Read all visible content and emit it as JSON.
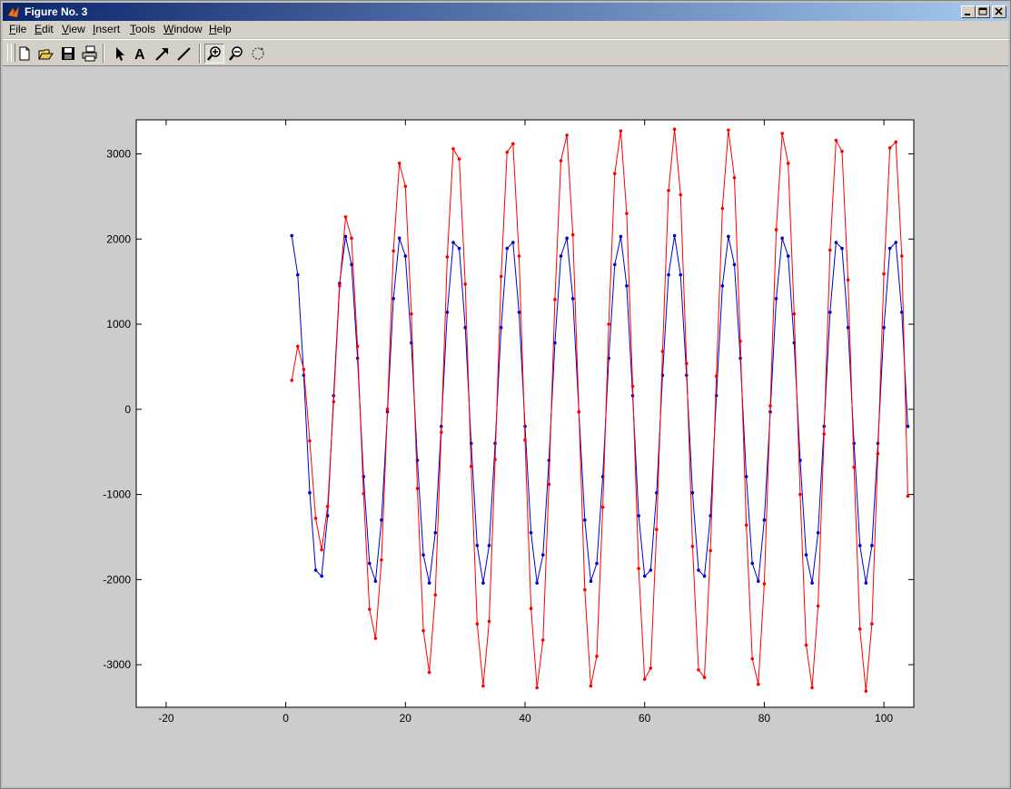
{
  "window": {
    "title": "Figure No. 3",
    "icon": "matlab-logo-icon"
  },
  "menu": [
    {
      "label": "File",
      "key": "F",
      "rest": "ile"
    },
    {
      "label": "Edit",
      "key": "E",
      "rest": "dit"
    },
    {
      "label": "View",
      "key": "V",
      "rest": "iew"
    },
    {
      "label": "Insert",
      "key": "I",
      "rest": "nsert"
    },
    {
      "label": "Tools",
      "key": "T",
      "rest": "ools"
    },
    {
      "label": "Window",
      "key": "W",
      "rest": "indow"
    },
    {
      "label": "Help",
      "key": "H",
      "rest": "elp"
    }
  ],
  "toolbar": [
    "new-file-icon",
    "open-file-icon",
    "save-icon",
    "print-icon",
    "arrow-select-icon",
    "insert-text-icon",
    "insert-arrow-icon",
    "insert-line-icon",
    "zoom-in-icon",
    "zoom-out-icon",
    "rotate-3d-icon"
  ],
  "chart_data": {
    "type": "line",
    "title": "",
    "xlabel": "",
    "ylabel": "",
    "xlim": [
      -25,
      105
    ],
    "ylim": [
      -3500,
      3400
    ],
    "xticks": [
      -20,
      0,
      20,
      40,
      60,
      80,
      100
    ],
    "yticks": [
      -3000,
      -2000,
      -1000,
      0,
      1000,
      2000,
      3000
    ],
    "colors": {
      "blue": "#0000cc",
      "red": "#ff0000"
    },
    "series": [
      {
        "color": "#0000cc",
        "marker": "dot",
        "x": [
          1,
          2,
          3,
          4,
          5,
          6,
          7,
          8,
          9,
          10,
          11,
          12,
          13,
          14,
          15,
          16,
          17,
          18,
          19,
          20,
          21,
          22,
          23,
          24,
          25,
          26,
          27,
          28,
          29,
          30,
          31,
          32,
          33,
          34,
          35,
          36,
          37,
          38,
          39,
          40,
          41,
          42,
          43,
          44,
          45,
          46,
          47,
          48,
          49,
          50,
          51,
          52,
          53,
          54,
          55,
          56,
          57,
          58,
          59,
          60,
          61,
          62,
          63,
          64,
          65,
          66,
          67,
          68,
          69,
          70,
          71,
          72,
          73,
          74,
          75,
          76,
          77,
          78,
          79,
          80,
          81,
          82,
          83,
          84,
          85,
          86,
          87,
          88,
          89,
          90,
          91,
          92,
          93,
          94,
          95,
          96,
          97,
          98,
          99,
          100,
          101,
          102,
          103,
          104
        ],
        "y": [
          2040,
          1580,
          400,
          -980,
          -1890,
          -1960,
          -1250,
          160,
          1480,
          2030,
          1700,
          600,
          -790,
          -1810,
          -2020,
          -1300,
          -30,
          1300,
          2010,
          1800,
          780,
          -600,
          -1710,
          -2040,
          -1450,
          -200,
          1140,
          1960,
          1890,
          960,
          -400,
          -1600,
          -2040,
          -1600,
          -400,
          960,
          1890,
          1960,
          1140,
          -200,
          -1450,
          -2040,
          -1710,
          -600,
          780,
          1800,
          2010,
          1300,
          -30,
          -1300,
          -2020,
          -1810,
          -790,
          600,
          1700,
          2030,
          1450,
          160,
          -1250,
          -1960,
          -1890,
          -980,
          400,
          1580,
          2040,
          1580,
          400,
          -980,
          -1890,
          -1960,
          -1250,
          160,
          1450,
          2030,
          1700,
          600,
          -790,
          -1810,
          -2020,
          -1300,
          -30,
          1300,
          2010,
          1800,
          780,
          -600,
          -1710,
          -2040,
          -1450,
          -200,
          1140,
          1960,
          1890,
          960,
          -400,
          -1600,
          -2040,
          -1600,
          -400,
          960,
          1890,
          1960,
          1140,
          -200
        ]
      },
      {
        "color": "#ff0000",
        "marker": "dot",
        "x": [
          1,
          2,
          3,
          4,
          5,
          6,
          7,
          8,
          9,
          10,
          11,
          12,
          13,
          14,
          15,
          16,
          17,
          18,
          19,
          20,
          21,
          22,
          23,
          24,
          25,
          26,
          27,
          28,
          29,
          30,
          31,
          32,
          33,
          34,
          35,
          36,
          37,
          38,
          39,
          40,
          41,
          42,
          43,
          44,
          45,
          46,
          47,
          48,
          49,
          50,
          51,
          52,
          53,
          54,
          55,
          56,
          57,
          58,
          59,
          60,
          61,
          62,
          63,
          64,
          65,
          66,
          67,
          68,
          69,
          70,
          71,
          72,
          73,
          74,
          75,
          76,
          77,
          78,
          79,
          80,
          81,
          82,
          83,
          84,
          85,
          86,
          87,
          88,
          89,
          90,
          91,
          92,
          93,
          94,
          95,
          96,
          97,
          98,
          99,
          100,
          101,
          102,
          103,
          104
        ],
        "y": [
          340,
          740,
          470,
          -370,
          -1280,
          -1650,
          -1140,
          90,
          1450,
          2260,
          2010,
          740,
          -990,
          -2350,
          -2690,
          -1770,
          0,
          1860,
          2890,
          2620,
          1120,
          -930,
          -2600,
          -3090,
          -2180,
          -270,
          1790,
          3060,
          2940,
          1470,
          -670,
          -2520,
          -3250,
          -2490,
          -590,
          1560,
          3020,
          3120,
          1800,
          -360,
          -2340,
          -3270,
          -2710,
          -880,
          1290,
          2920,
          3220,
          2050,
          -30,
          -2120,
          -3250,
          -2900,
          -1150,
          1000,
          2770,
          3270,
          2300,
          270,
          -1870,
          -3170,
          -3040,
          -1410,
          680,
          2570,
          3290,
          2520,
          540,
          -1610,
          -3060,
          -3150,
          -1660,
          390,
          2360,
          3280,
          2720,
          800,
          -1360,
          -2930,
          -3230,
          -2050,
          40,
          2110,
          3240,
          2890,
          1120,
          -1000,
          -2770,
          -3270,
          -2310,
          -290,
          1870,
          3160,
          3030,
          1520,
          -680,
          -2580,
          -3310,
          -2520,
          -520,
          1590,
          3070,
          3140,
          1800,
          -1020
        ]
      }
    ]
  }
}
